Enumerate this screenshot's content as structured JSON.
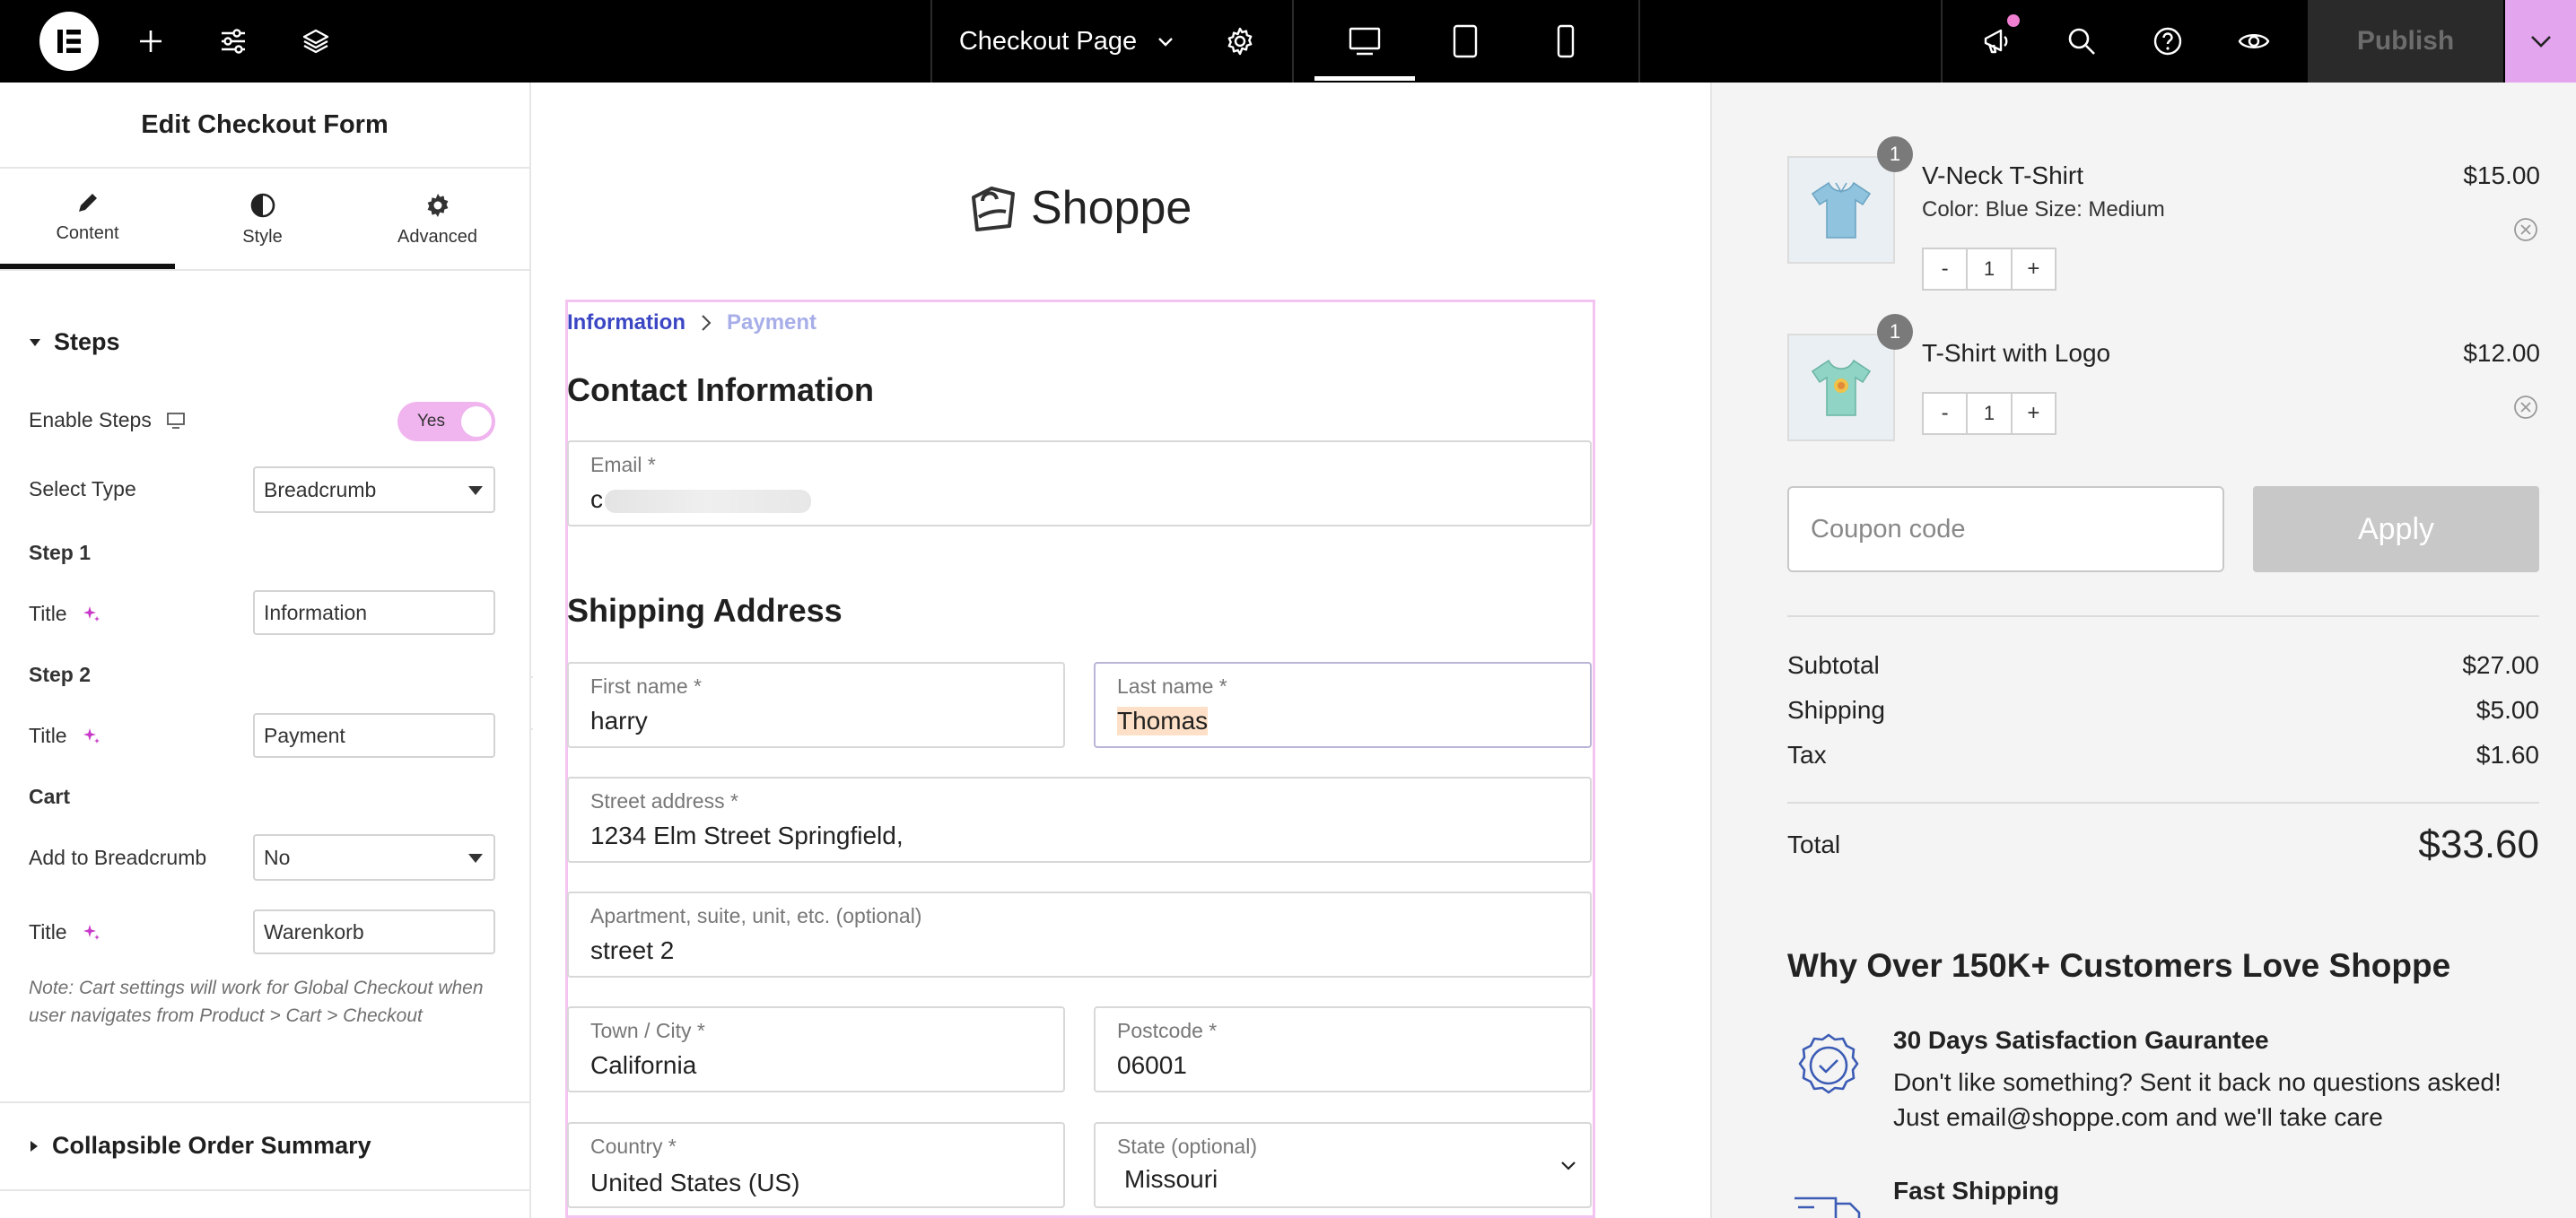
{
  "topbar": {
    "page_title": "Checkout Page",
    "publish_label": "Publish"
  },
  "panel": {
    "title": "Edit Checkout Form",
    "tabs": [
      {
        "label": "Content"
      },
      {
        "label": "Style"
      },
      {
        "label": "Advanced"
      }
    ],
    "steps_section": "Steps",
    "enable_steps_label": "Enable Steps",
    "enable_steps_value": "Yes",
    "select_type_label": "Select Type",
    "select_type_value": "Breadcrumb",
    "step1_heading": "Step 1",
    "step1_title_label": "Title",
    "step1_title_value": "Information",
    "step2_heading": "Step 2",
    "step2_title_label": "Title",
    "step2_title_value": "Payment",
    "cart_heading": "Cart",
    "add_breadcrumb_label": "Add to Breadcrumb",
    "add_breadcrumb_value": "No",
    "cart_title_label": "Title",
    "cart_title_value": "Warenkorb",
    "note": "Note: Cart settings will work for Global Checkout when user navigates from Product > Cart > Checkout",
    "collapsible_section": "Collapsible Order Summary"
  },
  "canvas": {
    "brand": "Shoppe",
    "breadcrumb": {
      "step1": "Information",
      "step2": "Payment"
    },
    "contact_heading": "Contact Information",
    "shipping_heading": "Shipping Address",
    "fields": {
      "email": {
        "label": "Email *",
        "value": "c"
      },
      "first_name": {
        "label": "First name *",
        "value": "harry"
      },
      "last_name": {
        "label": "Last name *",
        "value": "Thomas"
      },
      "street": {
        "label": "Street address *",
        "value": "1234 Elm Street Springfield,"
      },
      "apartment": {
        "label": "Apartment, suite, unit, etc. (optional)",
        "value": "street 2"
      },
      "city": {
        "label": "Town / City *",
        "value": "California"
      },
      "postcode": {
        "label": "Postcode *",
        "value": "06001"
      },
      "country": {
        "label": "Country *",
        "value": "United States (US)"
      },
      "state": {
        "label": "State (optional)",
        "value": "Missouri"
      }
    }
  },
  "summary": {
    "items": [
      {
        "badge": "1",
        "name": "V-Neck T-Shirt",
        "meta": "Color:  Blue Size:  Medium",
        "price": "$15.00",
        "qty": "1",
        "minus": "-",
        "plus": "+"
      },
      {
        "badge": "1",
        "name": "T-Shirt with Logo",
        "price": "$12.00",
        "qty": "1",
        "minus": "-",
        "plus": "+"
      }
    ],
    "coupon_placeholder": "Coupon code",
    "apply_label": "Apply",
    "subtotal_label": "Subtotal",
    "subtotal_value": "$27.00",
    "shipping_label": "Shipping",
    "shipping_value": "$5.00",
    "tax_label": "Tax",
    "tax_value": "$1.60",
    "total_label": "Total",
    "total_value": "$33.60",
    "why_heading": "Why Over 150K+ Customers Love Shoppe",
    "perks": [
      {
        "title": "30 Days Satisfaction Gaurantee",
        "text": "Don't like something? Sent it back no questions asked! Just email@shoppe.com and we'll take care"
      },
      {
        "title": "Fast Shipping"
      }
    ]
  },
  "colors": {
    "accent_pink": "#f0b4ef",
    "breadcrumb_active": "#3b46c4",
    "breadcrumb_inactive": "#a7aee8",
    "publish_caret": "#e3a5ee"
  },
  "icons": [
    "elementor-logo-icon",
    "plus-icon",
    "sliders-icon",
    "layers-icon",
    "chevron-down-icon",
    "gear-icon",
    "desktop-icon",
    "tablet-icon",
    "mobile-icon",
    "megaphone-icon",
    "search-icon",
    "help-icon",
    "eye-icon",
    "pencil-icon",
    "contrast-icon",
    "settings-icon",
    "monitor-icon",
    "ai-sparkle-icon",
    "remove-icon",
    "badge-icon",
    "truck-icon"
  ]
}
